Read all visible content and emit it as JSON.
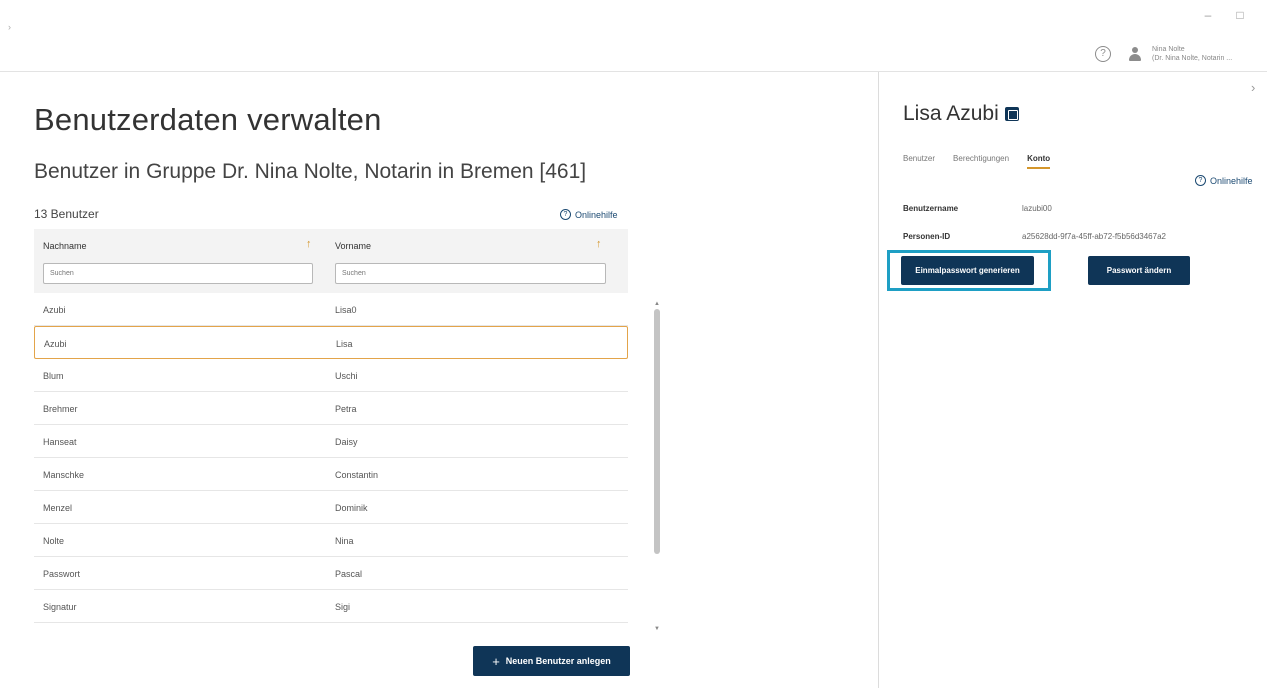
{
  "window": {
    "minimize_glyph": "–",
    "maximize_glyph": "□"
  },
  "header": {
    "user_line1": "Nina Nolte",
    "user_line2": "(Dr. Nina Nolte, Notarin ..."
  },
  "left": {
    "title": "Benutzerdaten verwalten",
    "group_title": "Benutzer in Gruppe Dr. Nina Nolte, Notarin in Bremen [461]",
    "count": "13 Benutzer",
    "help_label": "Onlinehilfe",
    "columns": [
      "Nachname",
      "Vorname"
    ],
    "search_placeholder": "Suchen",
    "rows": [
      {
        "last": "Azubi",
        "first": "Lisa0"
      },
      {
        "last": "Azubi",
        "first": "Lisa"
      },
      {
        "last": "Blum",
        "first": "Uschi"
      },
      {
        "last": "Brehmer",
        "first": "Petra"
      },
      {
        "last": "Hanseat",
        "first": "Daisy"
      },
      {
        "last": "Manschke",
        "first": "Constantin"
      },
      {
        "last": "Menzel",
        "first": "Dominik"
      },
      {
        "last": "Nolte",
        "first": "Nina"
      },
      {
        "last": "Passwort",
        "first": "Pascal"
      },
      {
        "last": "Signatur",
        "first": "Sigi"
      }
    ],
    "new_user_button": "Neuen Benutzer anlegen"
  },
  "right": {
    "title": "Lisa Azubi",
    "tabs": [
      "Benutzer",
      "Berechtigungen",
      "Konto"
    ],
    "help_label": "Onlinehilfe",
    "username_label": "Benutzername",
    "username_value": "lazubi00",
    "person_id_label": "Personen-ID",
    "person_id_value": "a25628dd-9f7a-45ff-ab72-f5b56d3467a2",
    "otp_button": "Einmalpasswort generieren",
    "change_pw_button": "Passwort ändern"
  },
  "colors": {
    "primary": "#0f3557",
    "accent": "#d4962b",
    "highlight": "#1e9fc4"
  }
}
